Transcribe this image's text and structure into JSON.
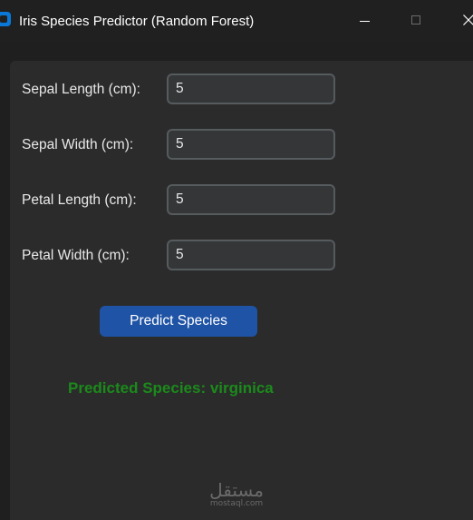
{
  "window": {
    "title": "Iris Species Predictor (Random Forest)"
  },
  "form": {
    "fields": [
      {
        "label": "Sepal Length (cm):",
        "value": "5"
      },
      {
        "label": "Sepal Width (cm):",
        "value": "5"
      },
      {
        "label": "Petal Length (cm):",
        "value": "5"
      },
      {
        "label": "Petal Width (cm):",
        "value": "5"
      }
    ],
    "predict_label": "Predict Species"
  },
  "result": {
    "text": "Predicted Species: virginica",
    "color": "#1b8a1b"
  },
  "watermark": {
    "arabic": "مستقل",
    "latin": "mostaql.com"
  },
  "colors": {
    "accent": "#1f53a5",
    "background": "#2b2b2b"
  }
}
